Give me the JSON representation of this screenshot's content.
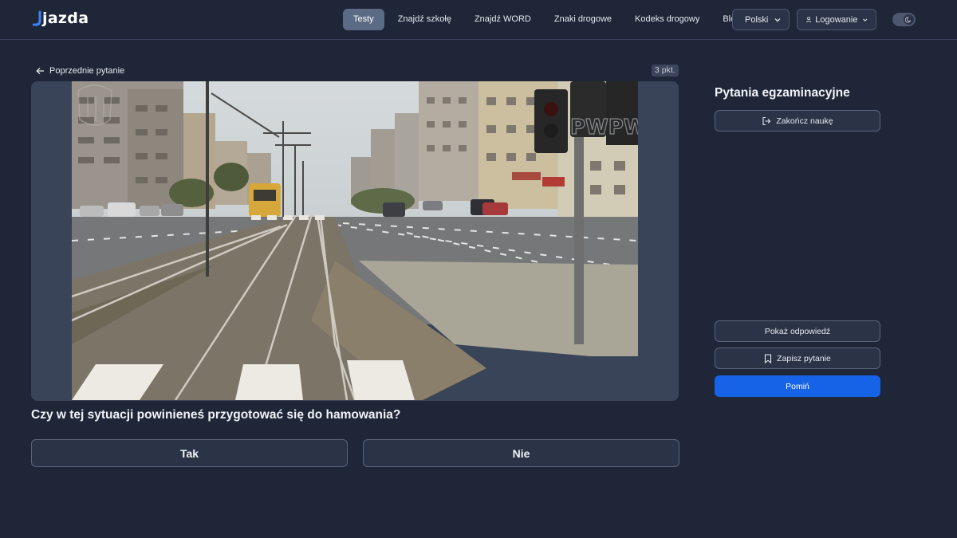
{
  "brand": {
    "logo_text": "jazda"
  },
  "nav": {
    "items": [
      {
        "label": "Testy",
        "active": true
      },
      {
        "label": "Znajdź szkołę"
      },
      {
        "label": "Znajdź WORD"
      },
      {
        "label": "Znaki drogowe"
      },
      {
        "label": "Kodeks drogowy"
      },
      {
        "label": "Blog"
      }
    ],
    "language": "Polski",
    "login": "Logowanie",
    "theme": "dark"
  },
  "question_panel": {
    "back_label": "Poprzednie pytanie",
    "points": "3 pkt.",
    "video_watermark": "PWPW",
    "question": "Czy w tej sytuacji powinieneś przygotować się do hamowania?",
    "answers": [
      "Tak",
      "Nie"
    ]
  },
  "sidebar": {
    "title": "Pytania egzaminacyjne",
    "end_label": "Zakończ naukę",
    "show_answer_label": "Pokaż odpowiedź",
    "save_label": "Zapisz pytanie",
    "skip_label": "Pomiń"
  },
  "colors": {
    "background": "#1e2638",
    "accent": "#1763e8",
    "active_nav": "#5c6b85"
  }
}
